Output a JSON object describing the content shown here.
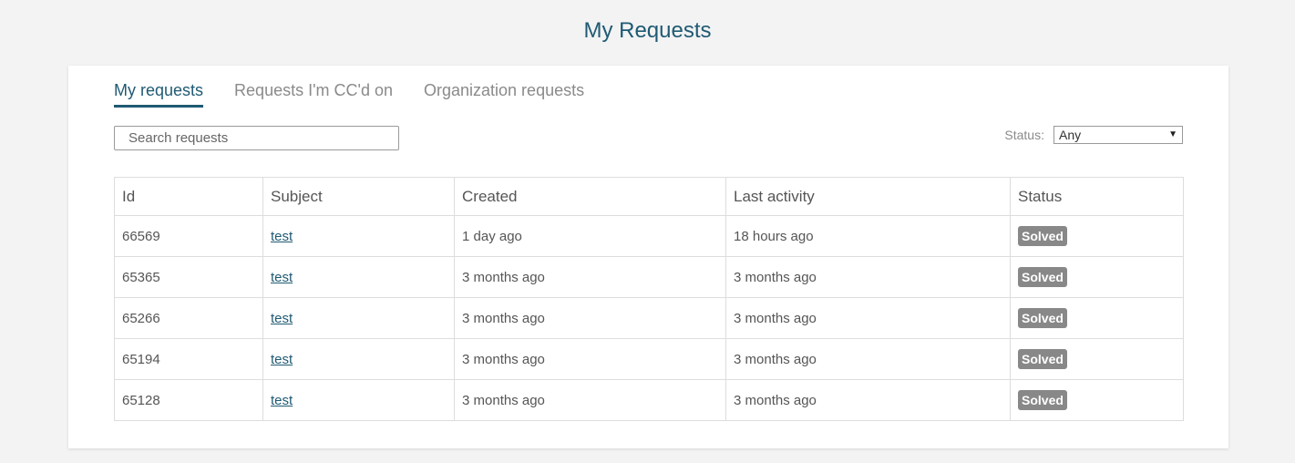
{
  "page": {
    "title": "My Requests"
  },
  "tabs": [
    {
      "label": "My requests",
      "active": true
    },
    {
      "label": "Requests I'm CC'd on",
      "active": false
    },
    {
      "label": "Organization requests",
      "active": false
    }
  ],
  "search": {
    "placeholder": "Search requests",
    "value": ""
  },
  "status_filter": {
    "label": "Status:",
    "selected": "Any"
  },
  "table": {
    "columns": [
      "Id",
      "Subject",
      "Created",
      "Last activity",
      "Status"
    ],
    "rows": [
      {
        "id": "66569",
        "subject": "test",
        "created": "1 day ago",
        "last_activity": "18 hours ago",
        "status": "Solved"
      },
      {
        "id": "65365",
        "subject": "test",
        "created": "3 months ago",
        "last_activity": "3 months ago",
        "status": "Solved"
      },
      {
        "id": "65266",
        "subject": "test",
        "created": "3 months ago",
        "last_activity": "3 months ago",
        "status": "Solved"
      },
      {
        "id": "65194",
        "subject": "test",
        "created": "3 months ago",
        "last_activity": "3 months ago",
        "status": "Solved"
      },
      {
        "id": "65128",
        "subject": "test",
        "created": "3 months ago",
        "last_activity": "3 months ago",
        "status": "Solved"
      }
    ]
  },
  "colors": {
    "accent": "#1f5a73",
    "badge": "#888888",
    "background": "#f3f3f3"
  }
}
